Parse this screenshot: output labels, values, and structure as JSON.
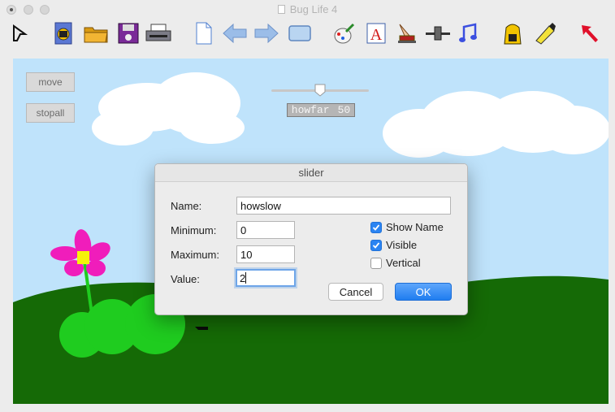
{
  "window": {
    "title": "Bug Life 4"
  },
  "toolbar": {
    "icons": [
      "pointer-tool",
      "open-project",
      "open-folder",
      "save-disk",
      "print",
      "new-page",
      "back-arrow",
      "forward-arrow",
      "rectangle",
      "paint",
      "text",
      "stamp",
      "slider-tool",
      "sound",
      "backpack",
      "highlighter",
      "red-arrow"
    ]
  },
  "stage": {
    "buttons": {
      "move": "move",
      "stopall": "stopall"
    },
    "slider": {
      "name": "howfar",
      "value": "50",
      "position_fraction": 0.5
    }
  },
  "dialog": {
    "title": "slider",
    "name_label": "Name:",
    "name_value": "howslow",
    "minimum_label": "Minimum:",
    "minimum_value": "0",
    "maximum_label": "Maximum:",
    "maximum_value": "10",
    "value_label": "Value:",
    "value_value": "2",
    "show_name_label": "Show Name",
    "show_name_checked": true,
    "visible_label": "Visible",
    "visible_checked": true,
    "vertical_label": "Vertical",
    "vertical_checked": false,
    "cancel_label": "Cancel",
    "ok_label": "OK"
  },
  "colors": {
    "sky": "#bfe3fb",
    "grass": "#156a06",
    "bug": "#1fcc1f",
    "flower": "#f01dbb",
    "accent": "#2b84f2"
  }
}
